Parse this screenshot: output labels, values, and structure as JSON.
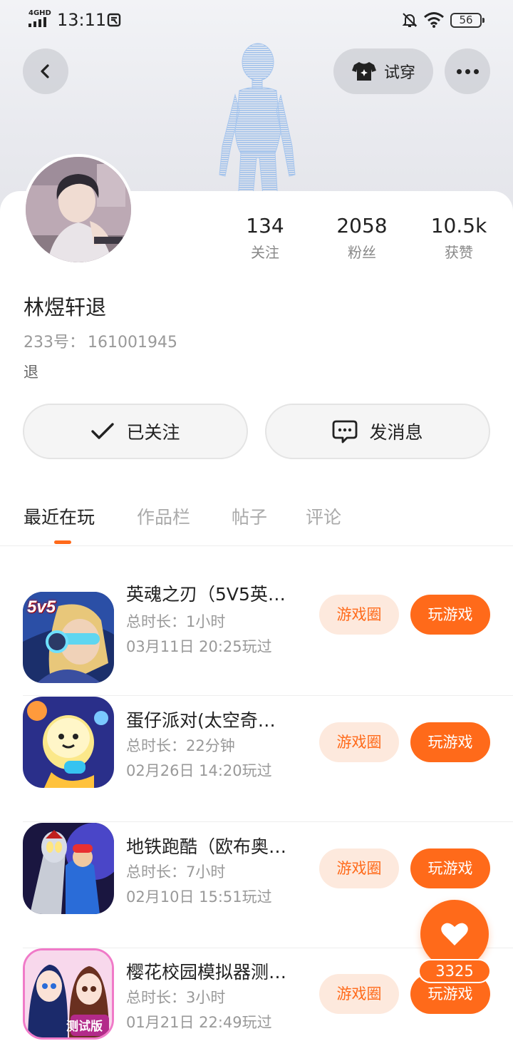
{
  "status_bar": {
    "network": "4GHD",
    "time": "13:11",
    "battery": "56"
  },
  "header": {
    "tryon_label": "试穿"
  },
  "profile": {
    "following_count": "134",
    "following_label": "关注",
    "fans_count": "2058",
    "fans_label": "粉丝",
    "likes_count": "10.5k",
    "likes_label": "获赞",
    "nickname": "林煜轩退",
    "uid_label": "233号：",
    "uid_value": "161001945",
    "bio": "退"
  },
  "actions": {
    "followed_label": "已关注",
    "message_label": "发消息"
  },
  "tabs": [
    {
      "label": "最近在玩",
      "active": true
    },
    {
      "label": "作品栏",
      "active": false
    },
    {
      "label": "帖子",
      "active": false
    },
    {
      "label": "评论",
      "active": false
    }
  ],
  "games": [
    {
      "name": "英魂之刃（5V5英…",
      "duration": "总时长：1小时",
      "last_played": "03月11日 20:25玩过",
      "circle_label": "游戏圈",
      "play_label": "玩游戏",
      "icon": "hero-game-icon",
      "icon_text": "5v5"
    },
    {
      "name": "蛋仔派对(太空奇…",
      "duration": "总时长：22分钟",
      "last_played": "02月26日 14:20玩过",
      "circle_label": "游戏圈",
      "play_label": "玩游戏",
      "icon": "eggy-party-icon"
    },
    {
      "name": "地铁跑酷（欧布奥…",
      "duration": "总时长：7小时",
      "last_played": "02月10日 15:51玩过",
      "circle_label": "游戏圈",
      "play_label": "玩游戏",
      "icon": "subway-surfers-icon"
    },
    {
      "name": "樱花校园模拟器测…",
      "duration": "总时长：3小时",
      "last_played": "01月21日 22:49玩过",
      "circle_label": "游戏圈",
      "play_label": "玩游戏",
      "icon": "sakura-school-icon",
      "icon_text": "测试版"
    }
  ],
  "like_fab": {
    "count": "3325"
  },
  "colors": {
    "accent": "#ff6a1a",
    "accent_light": "#fde9dd"
  }
}
